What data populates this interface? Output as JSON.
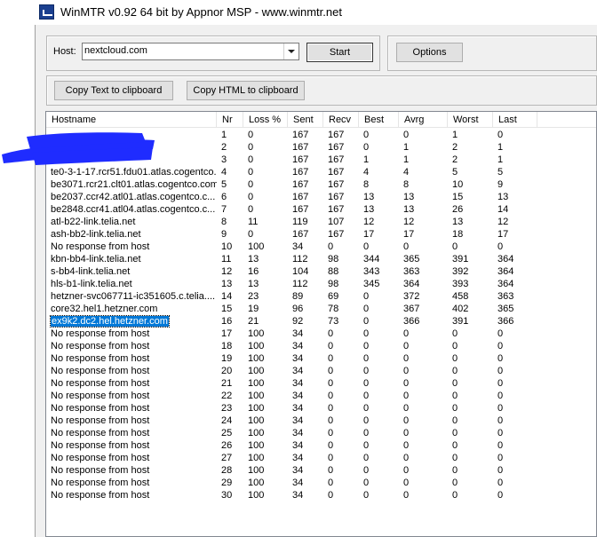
{
  "window": {
    "title": "WinMTR v0.92 64 bit by Appnor MSP - www.winmtr.net"
  },
  "controls": {
    "host_label": "Host:",
    "host_value": "nextcloud.com",
    "start_label": "Start",
    "options_label": "Options",
    "copy_text_label": "Copy Text to clipboard",
    "copy_html_label": "Copy HTML to clipboard"
  },
  "table": {
    "columns": [
      "Hostname",
      "Nr",
      "Loss %",
      "Sent",
      "Recv",
      "Best",
      "Avrg",
      "Worst",
      "Last"
    ],
    "rows": [
      [
        "",
        "1",
        "0",
        "167",
        "167",
        "0",
        "0",
        "1",
        "0"
      ],
      [
        "",
        "2",
        "0",
        "167",
        "167",
        "0",
        "1",
        "2",
        "1"
      ],
      [
        "",
        "3",
        "0",
        "167",
        "167",
        "1",
        "1",
        "2",
        "1"
      ],
      [
        "te0-3-1-17.rcr51.fdu01.atlas.cogentco...",
        "4",
        "0",
        "167",
        "167",
        "4",
        "4",
        "5",
        "5"
      ],
      [
        "be3071.rcr21.clt01.atlas.cogentco.com",
        "5",
        "0",
        "167",
        "167",
        "8",
        "8",
        "10",
        "9"
      ],
      [
        "be2037.ccr42.atl01.atlas.cogentco.c...",
        "6",
        "0",
        "167",
        "167",
        "13",
        "13",
        "15",
        "13"
      ],
      [
        "be2848.ccr41.atl04.atlas.cogentco.c...",
        "7",
        "0",
        "167",
        "167",
        "13",
        "13",
        "26",
        "14"
      ],
      [
        "atl-b22-link.telia.net",
        "8",
        "11",
        "119",
        "107",
        "12",
        "12",
        "13",
        "12"
      ],
      [
        "ash-bb2-link.telia.net",
        "9",
        "0",
        "167",
        "167",
        "17",
        "17",
        "18",
        "17"
      ],
      [
        "No response from host",
        "10",
        "100",
        "34",
        "0",
        "0",
        "0",
        "0",
        "0"
      ],
      [
        "kbn-bb4-link.telia.net",
        "11",
        "13",
        "112",
        "98",
        "344",
        "365",
        "391",
        "364"
      ],
      [
        "s-bb4-link.telia.net",
        "12",
        "16",
        "104",
        "88",
        "343",
        "363",
        "392",
        "364"
      ],
      [
        "hls-b1-link.telia.net",
        "13",
        "13",
        "112",
        "98",
        "345",
        "364",
        "393",
        "364"
      ],
      [
        "hetzner-svc067711-ic351605.c.telia....",
        "14",
        "23",
        "89",
        "69",
        "0",
        "372",
        "458",
        "363"
      ],
      [
        "core32.hel1.hetzner.com",
        "15",
        "19",
        "96",
        "78",
        "0",
        "367",
        "402",
        "365"
      ],
      [
        "ex9k2.dc2.hel.hetzner.com",
        "16",
        "21",
        "92",
        "73",
        "0",
        "366",
        "391",
        "366"
      ],
      [
        "No response from host",
        "17",
        "100",
        "34",
        "0",
        "0",
        "0",
        "0",
        "0"
      ],
      [
        "No response from host",
        "18",
        "100",
        "34",
        "0",
        "0",
        "0",
        "0",
        "0"
      ],
      [
        "No response from host",
        "19",
        "100",
        "34",
        "0",
        "0",
        "0",
        "0",
        "0"
      ],
      [
        "No response from host",
        "20",
        "100",
        "34",
        "0",
        "0",
        "0",
        "0",
        "0"
      ],
      [
        "No response from host",
        "21",
        "100",
        "34",
        "0",
        "0",
        "0",
        "0",
        "0"
      ],
      [
        "No response from host",
        "22",
        "100",
        "34",
        "0",
        "0",
        "0",
        "0",
        "0"
      ],
      [
        "No response from host",
        "23",
        "100",
        "34",
        "0",
        "0",
        "0",
        "0",
        "0"
      ],
      [
        "No response from host",
        "24",
        "100",
        "34",
        "0",
        "0",
        "0",
        "0",
        "0"
      ],
      [
        "No response from host",
        "25",
        "100",
        "34",
        "0",
        "0",
        "0",
        "0",
        "0"
      ],
      [
        "No response from host",
        "26",
        "100",
        "34",
        "0",
        "0",
        "0",
        "0",
        "0"
      ],
      [
        "No response from host",
        "27",
        "100",
        "34",
        "0",
        "0",
        "0",
        "0",
        "0"
      ],
      [
        "No response from host",
        "28",
        "100",
        "34",
        "0",
        "0",
        "0",
        "0",
        "0"
      ],
      [
        "No response from host",
        "29",
        "100",
        "34",
        "0",
        "0",
        "0",
        "0",
        "0"
      ],
      [
        "No response from host",
        "30",
        "100",
        "34",
        "0",
        "0",
        "0",
        "0",
        "0"
      ]
    ],
    "selected_row": 15
  },
  "colors": {
    "selection": "#0078d7",
    "redaction": "#1f2cff"
  },
  "icons": {
    "app": "winmtr-app-icon",
    "dropdown": "chevron-down-icon"
  }
}
